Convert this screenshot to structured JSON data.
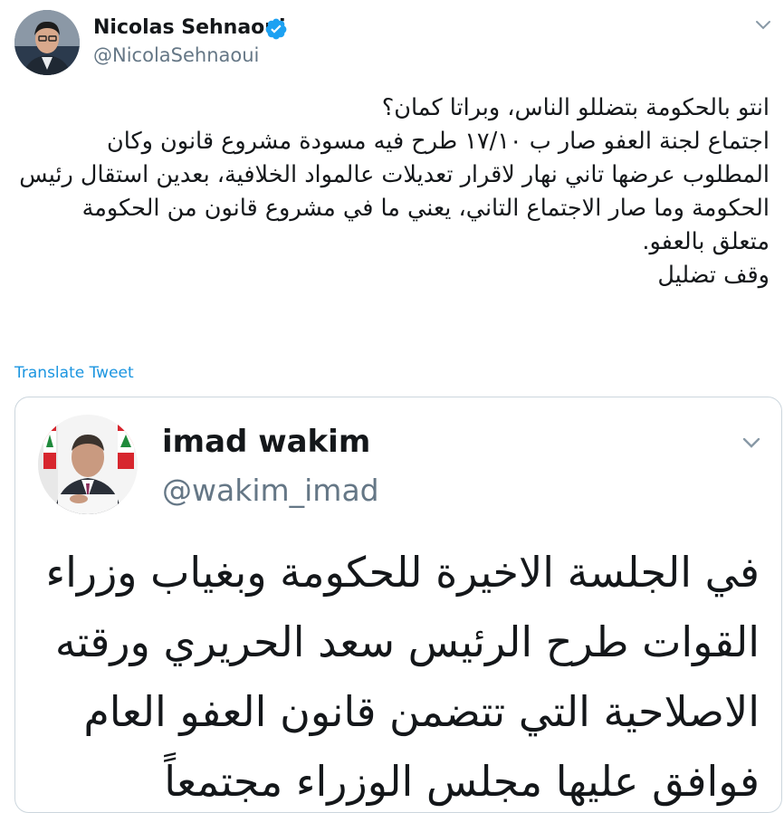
{
  "tweet": {
    "author_name": "Nicolas Sehnaoui",
    "author_handle": "@NicolaSehnaoui",
    "verified_icon": "verified-badge-icon",
    "body": "انتو بالحكومة بتضللو الناس، وبراتا كمان؟\nاجتماع لجنة العفو صار ب ١٧/١٠ طرح فيه مسودة مشروع قانون وكان المطلوب عرضها تاني نهار لاقرار تعديلات عالمواد الخلافية، بعدين استقال رئيس الحكومة وما صار الاجتماع التاني، يعني ما في مشروع قانون من الحكومة متعلق بالعفو.\nوقف تضليل",
    "translate_label": "Translate Tweet"
  },
  "quoted_tweet": {
    "author_name": "imad wakim",
    "author_handle": "@wakim_imad",
    "body": "في الجلسة الاخيرة للحكومة وبغياب وزراء القوات طرح الرئيس سعد الحريري ورقته الاصلاحية التي تتضمن قانون العفو العام فوافق عليها مجلس الوزراء مجتمعاً"
  },
  "colors": {
    "text": "#14171a",
    "secondary": "#657786",
    "link": "#1b95e0",
    "border": "#ccd6dd",
    "verified": "#1da1f2"
  }
}
